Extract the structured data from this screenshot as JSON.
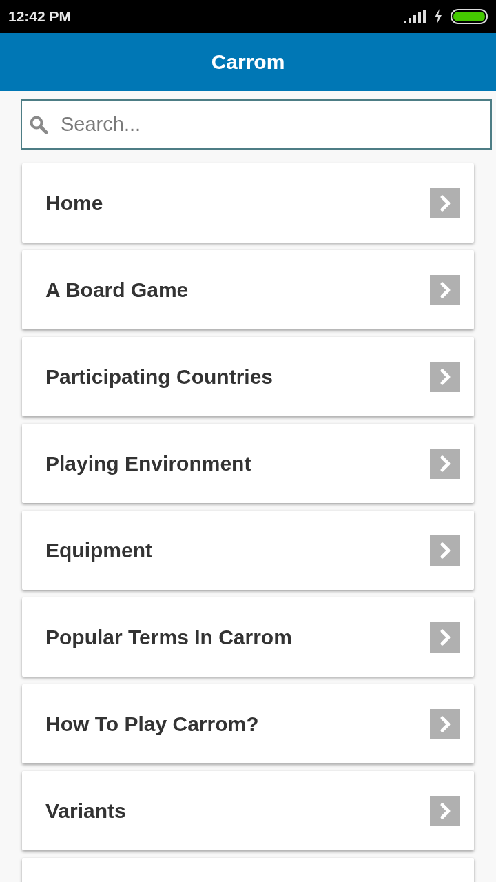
{
  "status_bar": {
    "time": "12:42 PM",
    "charging": true
  },
  "app_bar": {
    "title": "Carrom"
  },
  "search": {
    "placeholder": "Search..."
  },
  "menu": {
    "items": [
      {
        "label": "Home"
      },
      {
        "label": "A Board Game"
      },
      {
        "label": "Participating Countries"
      },
      {
        "label": "Playing Environment"
      },
      {
        "label": "Equipment"
      },
      {
        "label": "Popular Terms In Carrom"
      },
      {
        "label": "How To Play Carrom?"
      },
      {
        "label": "Variants"
      }
    ],
    "more_below": true
  }
}
